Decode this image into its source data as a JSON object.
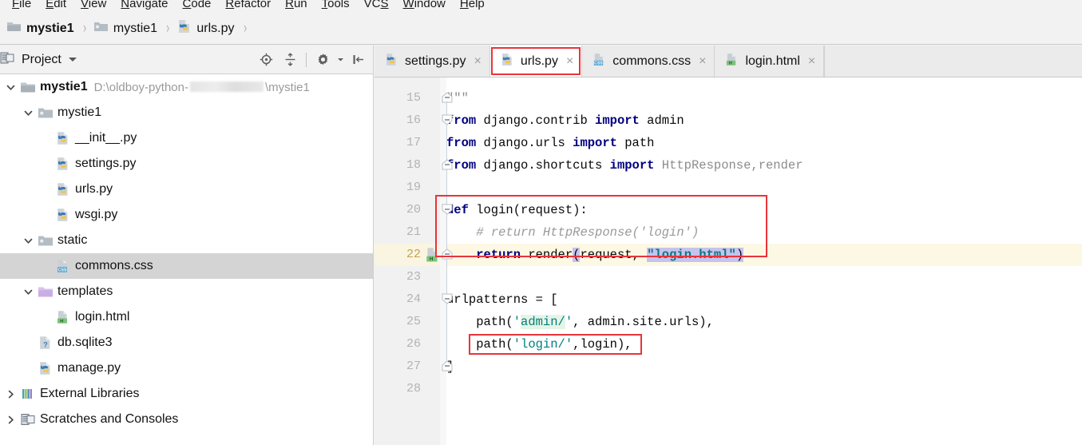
{
  "window": {
    "app": "PyCharm",
    "menu": [
      "File",
      "Edit",
      "View",
      "Navigate",
      "Code",
      "Refactor",
      "Run",
      "Tools",
      "VCS",
      "Window",
      "Help"
    ]
  },
  "breadcrumb": {
    "name": "breadcrumb",
    "items": [
      {
        "label": "mystie1",
        "icon": "folder-icon",
        "bold": true
      },
      {
        "label": "mystie1",
        "icon": "folder-module-icon",
        "bold": false
      },
      {
        "label": "urls.py",
        "icon": "python-file-icon",
        "bold": false
      }
    ],
    "separator": "›"
  },
  "project_panel": {
    "title": "Project",
    "caret": "chevron-down-icon",
    "tools": [
      {
        "name": "locate-target-icon",
        "title": "Select Opened File"
      },
      {
        "name": "collapse-all-icon",
        "title": "Collapse All"
      },
      {
        "name": "gear-icon",
        "title": "Settings"
      },
      {
        "name": "hide-panel-icon",
        "title": "Hide"
      }
    ],
    "tree": [
      {
        "label": "mystie1",
        "path": "D:\\oldboy-python-",
        "path_tail": "\\mystie1",
        "icon": "folder-icon",
        "indent": 0,
        "arrow": "expanded",
        "bold": true,
        "selected": false,
        "redacted": true
      },
      {
        "label": "mystie1",
        "icon": "folder-module-icon",
        "indent": 1,
        "arrow": "expanded",
        "bold": false,
        "selected": false
      },
      {
        "label": "__init__.py",
        "icon": "python-file-icon",
        "indent": 2,
        "arrow": "none",
        "bold": false,
        "selected": false
      },
      {
        "label": "settings.py",
        "icon": "python-file-icon",
        "indent": 2,
        "arrow": "none",
        "bold": false,
        "selected": false
      },
      {
        "label": "urls.py",
        "icon": "python-file-icon",
        "indent": 2,
        "arrow": "none",
        "bold": false,
        "selected": false
      },
      {
        "label": "wsgi.py",
        "icon": "python-file-icon",
        "indent": 2,
        "arrow": "none",
        "bold": false,
        "selected": false
      },
      {
        "label": "static",
        "icon": "folder-module-icon",
        "indent": 1,
        "arrow": "expanded",
        "bold": false,
        "selected": false
      },
      {
        "label": "commons.css",
        "icon": "css-file-icon",
        "indent": 2,
        "arrow": "none",
        "bold": false,
        "selected": true
      },
      {
        "label": "templates",
        "icon": "folder-templates-icon",
        "indent": 1,
        "arrow": "expanded",
        "bold": false,
        "selected": false
      },
      {
        "label": "login.html",
        "icon": "html-file-icon",
        "indent": 2,
        "arrow": "none",
        "bold": false,
        "selected": false
      },
      {
        "label": "db.sqlite3",
        "icon": "unknown-file-icon",
        "indent": 1,
        "arrow": "none",
        "bold": false,
        "selected": false
      },
      {
        "label": "manage.py",
        "icon": "python-file-icon",
        "indent": 1,
        "arrow": "none",
        "bold": false,
        "selected": false
      },
      {
        "label": "External Libraries",
        "icon": "libraries-icon",
        "indent": 0,
        "arrow": "collapsed",
        "bold": false,
        "selected": false
      },
      {
        "label": "Scratches and Consoles",
        "icon": "scratches-icon",
        "indent": 0,
        "arrow": "collapsed",
        "bold": false,
        "selected": false
      }
    ]
  },
  "editor": {
    "tabs": [
      {
        "label": "settings.py",
        "icon": "python-file-icon",
        "active": false,
        "outlined": false,
        "close": "×"
      },
      {
        "label": "urls.py",
        "icon": "python-file-icon",
        "active": true,
        "outlined": true,
        "close": "×"
      },
      {
        "label": "commons.css",
        "icon": "css-file-icon",
        "active": false,
        "outlined": false,
        "close": "×"
      },
      {
        "label": "login.html",
        "icon": "html-file-icon",
        "active": false,
        "outlined": false,
        "close": "×"
      }
    ],
    "first_line": 15,
    "current_line": 22,
    "gutter_icon_line": 22,
    "gutter_icon_name": "html-file-icon",
    "lines": [
      {
        "n": 15,
        "text": "\"\"\""
      },
      {
        "n": 16,
        "text": "from django.contrib import admin"
      },
      {
        "n": 17,
        "text": "from django.urls import path"
      },
      {
        "n": 18,
        "text": "from django.shortcuts import HttpResponse,render"
      },
      {
        "n": 19,
        "text": ""
      },
      {
        "n": 20,
        "text": "def login(request):"
      },
      {
        "n": 21,
        "text": "    # return HttpResponse('login')"
      },
      {
        "n": 22,
        "text": "    return render(request, \"login.html\")"
      },
      {
        "n": 23,
        "text": ""
      },
      {
        "n": 24,
        "text": "urlpatterns = ["
      },
      {
        "n": 25,
        "text": "    path('admin/', admin.site.urls),"
      },
      {
        "n": 26,
        "text": "    path('login/',login),"
      },
      {
        "n": 27,
        "text": "]"
      },
      {
        "n": 28,
        "text": ""
      }
    ],
    "annotations": [
      {
        "name": "annotation-login-function",
        "lines": [
          20,
          22
        ]
      },
      {
        "name": "annotation-login-route",
        "lines": [
          26,
          26
        ]
      }
    ]
  },
  "colors": {
    "accent_red": "#e8343a",
    "keyword": "#000080",
    "string": "#008080",
    "comment": "#9a9a9a",
    "current_line": "#fdf8e4",
    "selection": "#c6c3f0",
    "tree_selection": "#d4d4d4"
  }
}
